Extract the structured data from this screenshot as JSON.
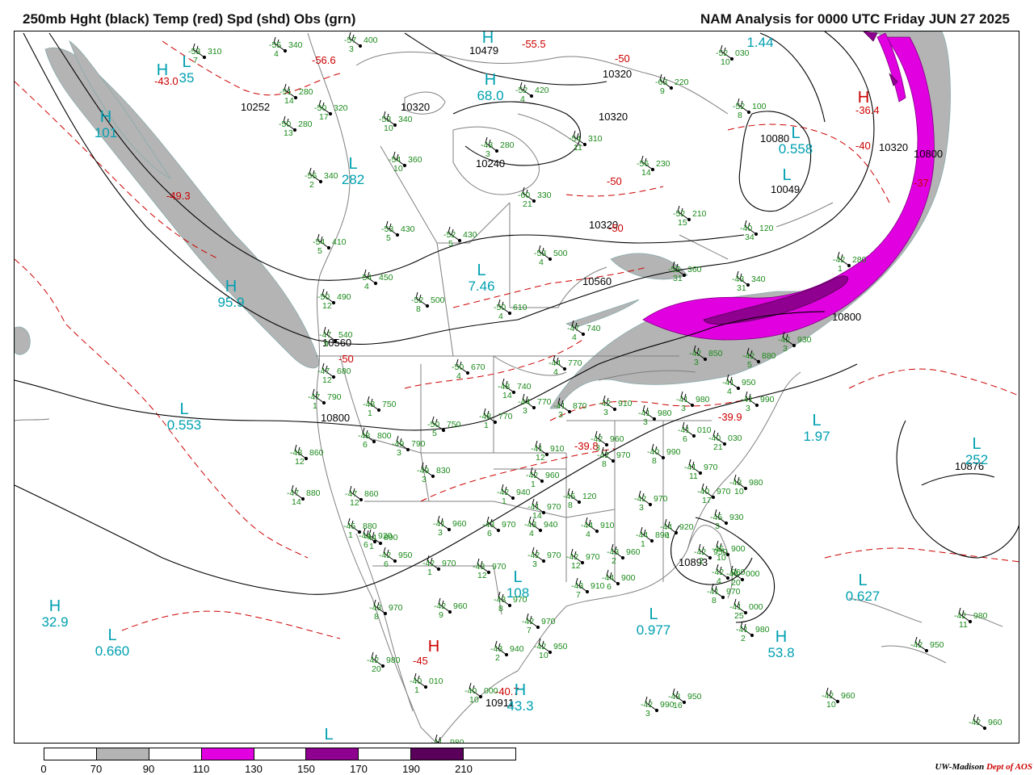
{
  "title_left": "250mb Hght (black) Temp (red) Spd (shd) Obs (grn)",
  "title_right": "NAM Analysis for 0000 UTC Friday  JUN 27 2025",
  "credit": {
    "org": "UW-Madison",
    "dept": "Dept of AOS"
  },
  "colors": {
    "height": "#000000",
    "temperature": "#cc0000",
    "speed_label": "#00a0b0",
    "obs": "#1a8a1a",
    "borders": "#808080"
  },
  "speed_legend": {
    "labels": [
      "0",
      "70",
      "90",
      "110",
      "130",
      "150",
      "170",
      "190",
      "210"
    ],
    "colors": [
      "#ffffff",
      "#b4b4b4",
      "#ffffff",
      "#e000e0",
      "#ffffff",
      "#900090",
      "#ffffff",
      "#5a005a",
      "#ffffff"
    ]
  },
  "height_labels": [
    {
      "text": "10479"
    },
    {
      "text": "10320"
    },
    {
      "text": "10252"
    },
    {
      "text": "10320"
    },
    {
      "text": "10320"
    },
    {
      "text": "10240"
    },
    {
      "text": "10080"
    },
    {
      "text": "10049"
    },
    {
      "text": "10320"
    },
    {
      "text": "10560"
    },
    {
      "text": "10320"
    },
    {
      "text": "10800"
    },
    {
      "text": "10800"
    },
    {
      "text": "10800"
    },
    {
      "text": "10876"
    },
    {
      "text": "10893"
    },
    {
      "text": "10911"
    },
    {
      "text": "10560"
    }
  ],
  "temp_labels": [
    {
      "text": "-56.6"
    },
    {
      "text": "-55.5"
    },
    {
      "text": "-50"
    },
    {
      "text": "-43.0"
    },
    {
      "text": "-49.3"
    },
    {
      "text": "-36.4"
    },
    {
      "text": "-40"
    },
    {
      "text": "-37"
    },
    {
      "text": "-50"
    },
    {
      "text": "-50"
    },
    {
      "text": "-39.9"
    },
    {
      "text": "-39.8"
    },
    {
      "text": "-40.7"
    },
    {
      "text": "-45"
    },
    {
      "text": "-50"
    }
  ],
  "pressure_centers": [
    {
      "letter": "H",
      "value": "",
      "kind": "H"
    },
    {
      "letter": "L",
      "value": "35",
      "kind": "L"
    },
    {
      "letter": "H",
      "value": "101",
      "kind": "H"
    },
    {
      "letter": "H",
      "value": "68.0",
      "kind": "H"
    },
    {
      "letter": "L",
      "value": "0.558",
      "kind": "L"
    },
    {
      "letter": "L",
      "value": "",
      "kind": "L"
    },
    {
      "letter": "L",
      "value": "282",
      "kind": "L"
    },
    {
      "letter": "L",
      "value": "7.46",
      "kind": "L"
    },
    {
      "letter": "H",
      "value": "95.9",
      "kind": "H"
    },
    {
      "letter": "L",
      "value": "0.553",
      "kind": "L"
    },
    {
      "letter": "L",
      "value": "1.97",
      "kind": "L"
    },
    {
      "letter": "L",
      "value": "252",
      "kind": "L"
    },
    {
      "letter": "H",
      "value": "32.9",
      "kind": "H"
    },
    {
      "letter": "L",
      "value": "0.660",
      "kind": "L"
    },
    {
      "letter": "L",
      "value": "108",
      "kind": "L"
    },
    {
      "letter": "L",
      "value": "0.977",
      "kind": "L"
    },
    {
      "letter": "L",
      "value": "0.627",
      "kind": "L"
    },
    {
      "letter": "H",
      "value": "53.8",
      "kind": "H"
    },
    {
      "letter": "H",
      "value": "43.3",
      "kind": "H"
    },
    {
      "letter": "L",
      "value": "",
      "kind": "L"
    },
    {
      "letter": "H",
      "value": "",
      "kind": "H"
    },
    {
      "letter": "L",
      "value": "1.44",
      "kind": "L"
    },
    {
      "letter": "H",
      "value": "",
      "kind": "H"
    },
    {
      "letter": "H",
      "value": "",
      "kind": "H"
    }
  ],
  "observations": [
    {
      "t": "-55",
      "h": "340",
      "s": "4"
    },
    {
      "t": "-53",
      "h": "310",
      "s": "7"
    },
    {
      "t": "-57",
      "h": "400",
      "s": "3"
    },
    {
      "t": "-51",
      "h": "280",
      "s": "14"
    },
    {
      "t": "-50",
      "h": "320",
      "s": "17"
    },
    {
      "t": "-50",
      "h": "280",
      "s": "13"
    },
    {
      "t": "-53",
      "h": "340",
      "s": "10"
    },
    {
      "t": "-52",
      "h": "420",
      "s": "4"
    },
    {
      "t": "-43",
      "h": "280",
      "s": "3"
    },
    {
      "t": "-54",
      "h": "310",
      "s": "11"
    },
    {
      "t": "-52",
      "h": "030",
      "s": "10"
    },
    {
      "t": "-63",
      "h": "220",
      "s": "9"
    },
    {
      "t": "-52",
      "h": "100",
      "s": "8"
    },
    {
      "t": "-56",
      "h": "230",
      "s": "14"
    },
    {
      "t": "-54",
      "h": "360",
      "s": "10"
    },
    {
      "t": "-56",
      "h": "340",
      "s": "2"
    },
    {
      "t": "-60",
      "h": "330",
      "s": "21"
    },
    {
      "t": "-52",
      "h": "210",
      "s": "15"
    },
    {
      "t": "-40",
      "h": "120",
      "s": "34"
    },
    {
      "t": "-53",
      "h": "430",
      "s": "5"
    },
    {
      "t": "-52",
      "h": "430",
      "s": "5"
    },
    {
      "t": "-54",
      "h": "410",
      "s": "5"
    },
    {
      "t": "-53",
      "h": "500",
      "s": "4"
    },
    {
      "t": "-42",
      "h": "280",
      "s": "1"
    },
    {
      "t": "-55",
      "h": "360",
      "s": "31"
    },
    {
      "t": "-43",
      "h": "340",
      "s": "31"
    },
    {
      "t": "-54",
      "h": "450",
      "s": "4"
    },
    {
      "t": "-50",
      "h": "490",
      "s": "12"
    },
    {
      "t": "-52",
      "h": "500",
      "s": "8"
    },
    {
      "t": "-50",
      "h": "610",
      "s": "4"
    },
    {
      "t": "-47",
      "h": "740",
      "s": "4"
    },
    {
      "t": "-47",
      "h": "540",
      "s": "9"
    },
    {
      "t": "-47",
      "h": "680",
      "s": "12"
    },
    {
      "t": "-44",
      "h": "770",
      "s": "4"
    },
    {
      "t": "-42",
      "h": "850",
      "s": "3"
    },
    {
      "t": "-42",
      "h": "880",
      "s": "5"
    },
    {
      "t": "-42",
      "h": "930",
      "s": "3"
    },
    {
      "t": "-50",
      "h": "670",
      "s": "4"
    },
    {
      "t": "-48",
      "h": "740",
      "s": "14"
    },
    {
      "t": "-47",
      "h": "790",
      "s": "1"
    },
    {
      "t": "-48",
      "h": "750",
      "s": "1"
    },
    {
      "t": "-44",
      "h": "770",
      "s": "3"
    },
    {
      "t": "-41",
      "h": "870",
      "s": "3"
    },
    {
      "t": "-42",
      "h": "910",
      "s": "3"
    },
    {
      "t": "-41",
      "h": "980",
      "s": "3"
    },
    {
      "t": "-41",
      "h": "950",
      "s": "4"
    },
    {
      "t": "-41",
      "h": "990",
      "s": "3"
    },
    {
      "t": "-48",
      "h": "770",
      "s": "1"
    },
    {
      "t": "-50",
      "h": "750",
      "s": "5"
    },
    {
      "t": "-48",
      "h": "800",
      "s": "6"
    },
    {
      "t": "-49",
      "h": "790",
      "s": "3"
    },
    {
      "t": "-41",
      "h": "980",
      "s": "3"
    },
    {
      "t": "-41",
      "h": "010",
      "s": "6"
    },
    {
      "t": "-40",
      "h": "030",
      "s": "21"
    },
    {
      "t": "-48",
      "h": "860",
      "s": "12"
    },
    {
      "t": "-41",
      "h": "910",
      "s": "12"
    },
    {
      "t": "-42",
      "h": "960",
      "s": "3"
    },
    {
      "t": "-42",
      "h": "970",
      "s": "8"
    },
    {
      "t": "-40",
      "h": "990",
      "s": "8"
    },
    {
      "t": "-41",
      "h": "970",
      "s": "11"
    },
    {
      "t": "-40",
      "h": "970",
      "s": "17"
    },
    {
      "t": "-43",
      "h": "980",
      "s": "10"
    },
    {
      "t": "-49",
      "h": "830",
      "s": "3"
    },
    {
      "t": "-42",
      "h": "960",
      "s": "1"
    },
    {
      "t": "-47",
      "h": "880",
      "s": "14"
    },
    {
      "t": "-47",
      "h": "860",
      "s": "12"
    },
    {
      "t": "-42",
      "h": "940",
      "s": "1"
    },
    {
      "t": "-41",
      "h": "970",
      "s": "14"
    },
    {
      "t": "-45",
      "h": "120",
      "s": "8"
    },
    {
      "t": "-42",
      "h": "970",
      "s": "3"
    },
    {
      "t": "-45",
      "h": "930",
      "s": "3"
    },
    {
      "t": "-45",
      "h": "900",
      "s": "10"
    },
    {
      "t": "-45",
      "h": "880",
      "s": "1"
    },
    {
      "t": "-44",
      "h": "890",
      "s": "1"
    },
    {
      "t": "-44",
      "h": "920",
      "s": "6"
    },
    {
      "t": "-42",
      "h": "950",
      "s": "6"
    },
    {
      "t": "-41",
      "h": "960",
      "s": "3"
    },
    {
      "t": "-43",
      "h": "970",
      "s": "6"
    },
    {
      "t": "-43",
      "h": "940",
      "s": "4"
    },
    {
      "t": "-44",
      "h": "910",
      "s": "4"
    },
    {
      "t": "-44",
      "h": "890",
      "s": "1"
    },
    {
      "t": "-44",
      "h": "920",
      "s": "4"
    },
    {
      "t": "-42",
      "h": "950",
      "s": "2"
    },
    {
      "t": "-42",
      "h": "960",
      "s": "4"
    },
    {
      "t": "-42",
      "h": "970",
      "s": "1"
    },
    {
      "t": "-43",
      "h": "970",
      "s": "12"
    },
    {
      "t": "-42",
      "h": "970",
      "s": "3"
    },
    {
      "t": "-42",
      "h": "970",
      "s": "12"
    },
    {
      "t": "-43",
      "h": "960",
      "s": "2"
    },
    {
      "t": "-44",
      "h": "900",
      "s": "6"
    },
    {
      "t": "-43",
      "h": "910",
      "s": "7"
    },
    {
      "t": "-43",
      "h": "000",
      "s": "20"
    },
    {
      "t": "-41",
      "h": "970",
      "s": "8"
    },
    {
      "t": "-43",
      "h": "970",
      "s": "8"
    },
    {
      "t": "-42",
      "h": "960",
      "s": "9"
    },
    {
      "t": "-43",
      "h": "970",
      "s": "8"
    },
    {
      "t": "-42",
      "h": "970",
      "s": "7"
    },
    {
      "t": "-43",
      "h": "940",
      "s": "2"
    },
    {
      "t": "-42",
      "h": "950",
      "s": "10"
    },
    {
      "t": "-41",
      "h": "000",
      "s": "25"
    },
    {
      "t": "-41",
      "h": "980",
      "s": "2"
    },
    {
      "t": "-42",
      "h": "980",
      "s": "20"
    },
    {
      "t": "-40",
      "h": "010",
      "s": "1"
    },
    {
      "t": "-40",
      "h": "000",
      "s": "10"
    },
    {
      "t": "-42",
      "h": "990",
      "s": "3"
    },
    {
      "t": "-43",
      "h": "950",
      "s": "16"
    },
    {
      "t": "-42",
      "h": "960",
      "s": "10"
    },
    {
      "t": "-42",
      "h": "980",
      "s": "11"
    },
    {
      "t": "-42",
      "h": "950",
      "s": ""
    },
    {
      "t": "-42",
      "h": "960",
      "s": ""
    },
    {
      "t": "-41",
      "h": "980",
      "s": ""
    }
  ]
}
